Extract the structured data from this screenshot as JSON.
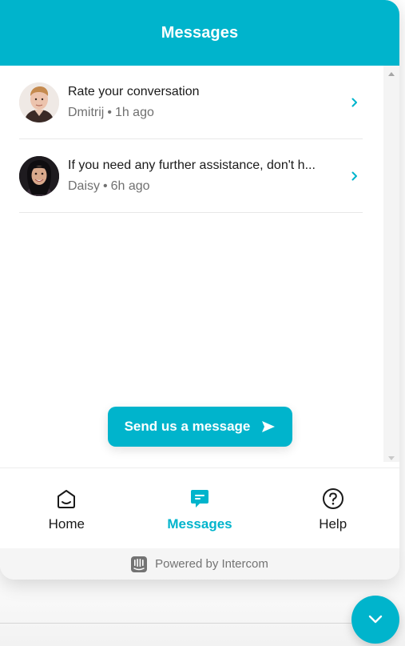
{
  "header": {
    "title": "Messages"
  },
  "conversations": [
    {
      "title": "Rate your conversation",
      "author": "Dmitrij",
      "separator": "•",
      "time": "1h ago",
      "avatar_icon": "avatar-dmitrij"
    },
    {
      "title": "If you need any further assistance, don't h...",
      "author": "Daisy",
      "separator": "•",
      "time": "6h ago",
      "avatar_icon": "avatar-daisy"
    }
  ],
  "send_button": {
    "label": "Send us a message",
    "icon": "send-arrow-icon"
  },
  "nav": {
    "items": [
      {
        "label": "Home",
        "icon": "home-icon",
        "active": false
      },
      {
        "label": "Messages",
        "icon": "messages-icon",
        "active": true
      },
      {
        "label": "Help",
        "icon": "help-icon",
        "active": false
      }
    ]
  },
  "footer": {
    "powered_by": "Powered by Intercom",
    "icon": "intercom-logo-icon"
  },
  "launcher": {
    "icon": "chevron-down-icon"
  },
  "colors": {
    "accent": "#00b4cc",
    "text": "#1a1a1a",
    "muted": "#707070"
  }
}
